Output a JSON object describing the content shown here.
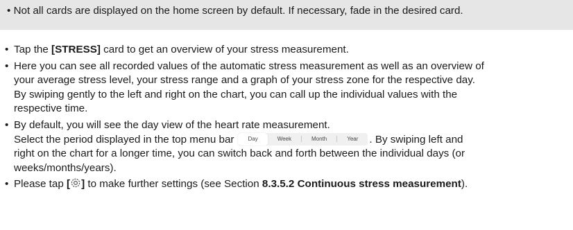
{
  "note": {
    "bullet": "•",
    "text": "Not all cards are displayed on the home screen by default. If necessary, fade in the desired card."
  },
  "items": [
    {
      "bullet": "•",
      "pre": "Tap the ",
      "bold": "[STRESS]",
      "post": " card to get an overview of your stress measurement."
    },
    {
      "bullet": "•",
      "line1": "Here you can see all recorded values of the automatic stress measurement as well as an overview of",
      "line2": "your average stress level, your stress range and a graph of your stress zone for the respective day.",
      "line3": "By swiping gently to the left and right on the chart, you can call up the individual values with the",
      "line4": "respective time."
    },
    {
      "bullet": "•",
      "line1": "By default, you will see the day view of the heart rate measurement.",
      "line2_pre": "Select the period displayed in the top menu bar",
      "line2_post": ". By swiping left and",
      "line3": "right on the chart for a longer time, you can switch back and forth between the individual days (or",
      "line4": "weeks/months/years)."
    },
    {
      "bullet": "•",
      "pre": "Please tap ",
      "bracket_open": "[",
      "bracket_close": "]",
      "mid": " to make further settings (see Section ",
      "bold": "8.3.5.2 Continuous stress measurement",
      "post": ")."
    }
  ],
  "period_menu": {
    "options": [
      "Day",
      "Week",
      "Month",
      "Year"
    ],
    "selected": "Day"
  },
  "icons": {
    "settings": "gear-icon"
  }
}
